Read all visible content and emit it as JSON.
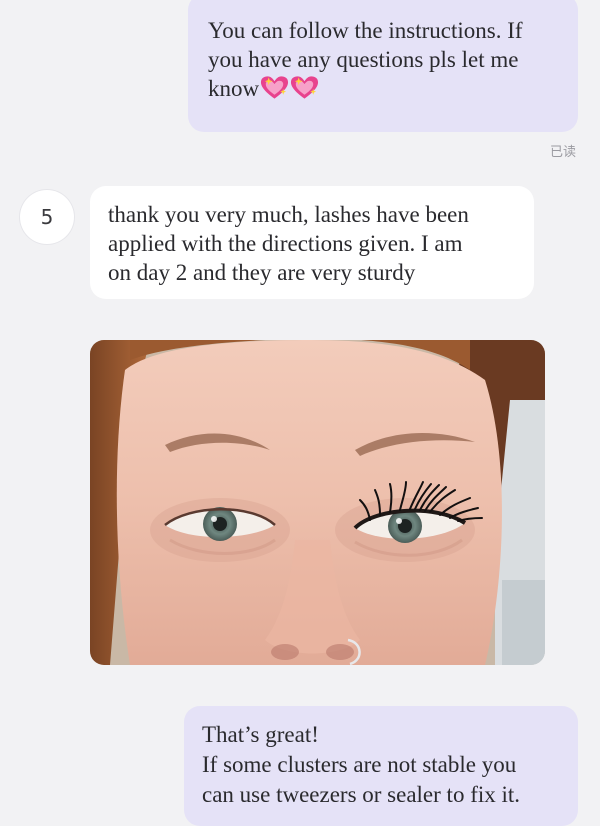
{
  "conversation": {
    "messages": [
      {
        "sender": "self",
        "text_line1": "You can follow the instructions. If",
        "text_line2": "you have any questions pls let me",
        "text_line3": "know",
        "emoji": "sparkling-heart-icon",
        "read_status": "已读"
      },
      {
        "sender": "other",
        "avatar_label": "5",
        "text_line1": "thank you very much, lashes have been",
        "text_line2": "applied with the directions given. I am",
        "text_line3": "on day 2 and they are very sturdy"
      },
      {
        "sender": "other",
        "type": "image",
        "image_subject": "close-up of eyes with lash extensions"
      },
      {
        "sender": "self",
        "text_line1": "That’s great!",
        "text_line2": "If some clusters are not stable you",
        "text_line3": "can use tweezers or sealer to fix it."
      }
    ]
  },
  "colors": {
    "outgoing_bubble": "#e5e2f7",
    "incoming_bubble": "#ffffff",
    "background": "#f2f2f4",
    "heart_pink": "#e8438e"
  }
}
